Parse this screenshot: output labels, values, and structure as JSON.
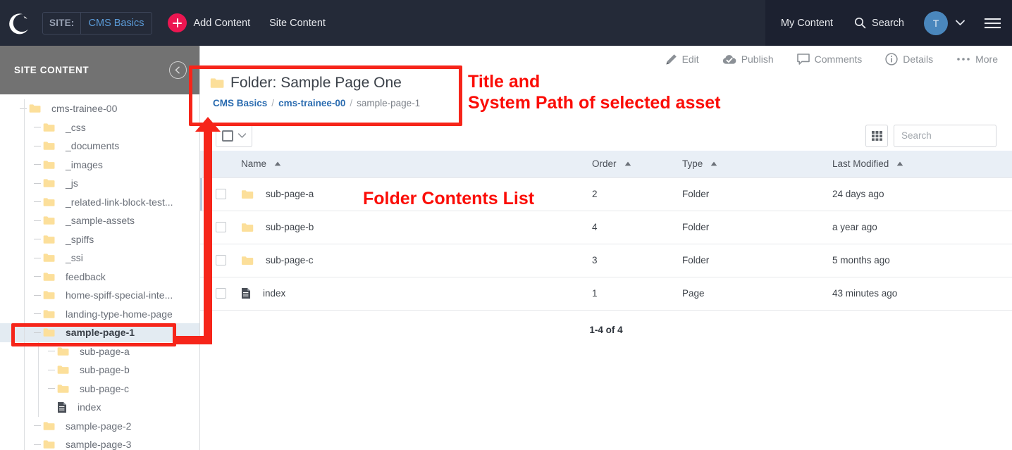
{
  "topbar": {
    "logo_icon": "crescent-moon-logo",
    "site_label": "SITE:",
    "site_value": "CMS Basics",
    "add_content_label": "Add Content",
    "site_content_label": "Site Content",
    "my_content_label": "My Content",
    "search_label": "Search",
    "search_icon": "magnifier-icon",
    "avatar_initial": "T",
    "caret_icon": "chevron-down-icon",
    "menu_icon": "hamburger-menu-icon",
    "bg_color": "#242a38",
    "accent_color": "#ec1651"
  },
  "sidebar": {
    "header_title": "SITE CONTENT",
    "collapse_icon": "chevron-left-circle-icon",
    "tree": [
      {
        "label": "cms-trainee-00",
        "depth": 0,
        "icon": "folder-icon",
        "selected": false
      },
      {
        "label": "_css",
        "depth": 1,
        "icon": "folder-icon",
        "selected": false
      },
      {
        "label": "_documents",
        "depth": 1,
        "icon": "folder-icon",
        "selected": false
      },
      {
        "label": "_images",
        "depth": 1,
        "icon": "folder-icon",
        "selected": false
      },
      {
        "label": "_js",
        "depth": 1,
        "icon": "folder-icon",
        "selected": false
      },
      {
        "label": "_related-link-block-test...",
        "depth": 1,
        "icon": "folder-icon",
        "selected": false
      },
      {
        "label": "_sample-assets",
        "depth": 1,
        "icon": "folder-icon",
        "selected": false
      },
      {
        "label": "_spiffs",
        "depth": 1,
        "icon": "folder-icon",
        "selected": false
      },
      {
        "label": "_ssi",
        "depth": 1,
        "icon": "folder-icon",
        "selected": false
      },
      {
        "label": "feedback",
        "depth": 1,
        "icon": "folder-icon",
        "selected": false
      },
      {
        "label": "home-spiff-special-inte...",
        "depth": 1,
        "icon": "folder-icon",
        "selected": false
      },
      {
        "label": "landing-type-home-page",
        "depth": 1,
        "icon": "folder-icon",
        "selected": false
      },
      {
        "label": "sample-page-1",
        "depth": 1,
        "icon": "folder-icon",
        "selected": true
      },
      {
        "label": "sub-page-a",
        "depth": 2,
        "icon": "folder-icon",
        "selected": false
      },
      {
        "label": "sub-page-b",
        "depth": 2,
        "icon": "folder-icon",
        "selected": false
      },
      {
        "label": "sub-page-c",
        "depth": 2,
        "icon": "folder-icon",
        "selected": false
      },
      {
        "label": "index",
        "depth": 2,
        "icon": "page-icon",
        "selected": false
      },
      {
        "label": "sample-page-2",
        "depth": 1,
        "icon": "folder-icon",
        "selected": false
      },
      {
        "label": "sample-page-3",
        "depth": 1,
        "icon": "folder-icon",
        "selected": false
      }
    ]
  },
  "actions": [
    {
      "label": "Edit",
      "icon": "pencil-icon"
    },
    {
      "label": "Publish",
      "icon": "cloud-check-icon"
    },
    {
      "label": "Comments",
      "icon": "speech-bubble-icon"
    },
    {
      "label": "Details",
      "icon": "info-circle-icon"
    },
    {
      "label": "More",
      "icon": "ellipsis-icon"
    }
  ],
  "asset": {
    "icon": "folder-icon",
    "title": "Folder: Sample Page One",
    "breadcrumb": [
      {
        "text": "CMS Basics",
        "type": "link"
      },
      {
        "text": "/",
        "type": "sep"
      },
      {
        "text": "cms-trainee-00",
        "type": "link"
      },
      {
        "text": "/",
        "type": "sep"
      },
      {
        "text": "sample-page-1",
        "type": "current"
      }
    ]
  },
  "toolbar": {
    "bulk_checkbox_icon": "checkbox-icon",
    "bulk_caret_icon": "chevron-down-icon",
    "grid_view_icon": "grid-view-icon",
    "search_placeholder": "Search",
    "search_value": ""
  },
  "table": {
    "columns": [
      {
        "label": "Name",
        "sort": "asc"
      },
      {
        "label": "Order",
        "sort": "asc"
      },
      {
        "label": "Type",
        "sort": "asc"
      },
      {
        "label": "Last Modified",
        "sort": "asc"
      }
    ],
    "rows": [
      {
        "name": "sub-page-a",
        "icon": "folder-icon",
        "order": "2",
        "type": "Folder",
        "modified": "24 days ago",
        "highlighted": true
      },
      {
        "name": "sub-page-b",
        "icon": "folder-icon",
        "order": "4",
        "type": "Folder",
        "modified": "a year ago",
        "highlighted": false
      },
      {
        "name": "sub-page-c",
        "icon": "folder-icon",
        "order": "3",
        "type": "Folder",
        "modified": "5 months ago",
        "highlighted": false
      },
      {
        "name": "index",
        "icon": "page-icon",
        "order": "1",
        "type": "Page",
        "modified": "43 minutes ago",
        "highlighted": false
      }
    ],
    "pagination": "1-4 of 4"
  },
  "annotations": {
    "color": "#f6251a",
    "title_path_label": "Title and\nSystem Path of selected asset",
    "folder_contents_label": "Folder Contents List"
  }
}
